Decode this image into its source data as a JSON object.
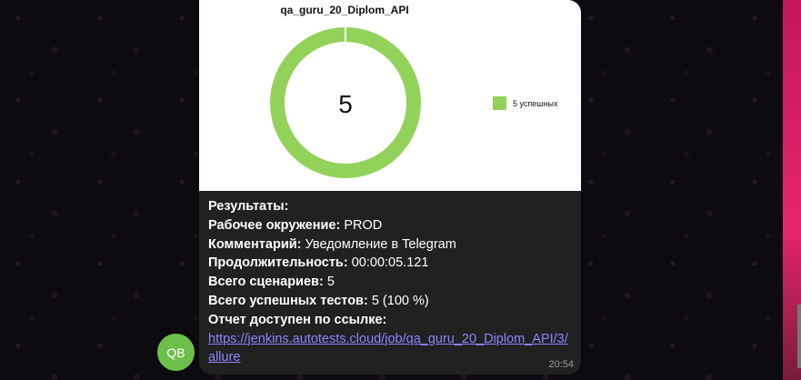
{
  "chart": {
    "title": "qa_guru_20_Diplom_API",
    "center_value": "5",
    "legend_label": "5 успешных",
    "ring_color": "#92d25a"
  },
  "chart_data": {
    "type": "pie",
    "title": "qa_guru_20_Diplom_API",
    "categories": [
      "5 успешных"
    ],
    "values": [
      5
    ],
    "center_label": "5",
    "legend": "right"
  },
  "message": {
    "results_heading": "Результаты:",
    "env_label": "Рабочее окружение:",
    "env_value": "PROD",
    "comment_label": "Комментарий:",
    "comment_value": "Уведомление в Telegram",
    "duration_label": "Продолжительность:",
    "duration_value": "00:00:05.121",
    "scenarios_label": "Всего сценариев:",
    "scenarios_value": "5",
    "passed_label": "Всего успешных тестов:",
    "passed_value": "5 (100 %)",
    "report_label": "Отчет доступен по ссылке:",
    "report_link": "https://jenkins.autotests.cloud/job/qa_guru_20_Diplom_API/3/allure",
    "time": "20:54"
  },
  "avatar": {
    "initials": "QB",
    "color": "#6cc04a"
  }
}
